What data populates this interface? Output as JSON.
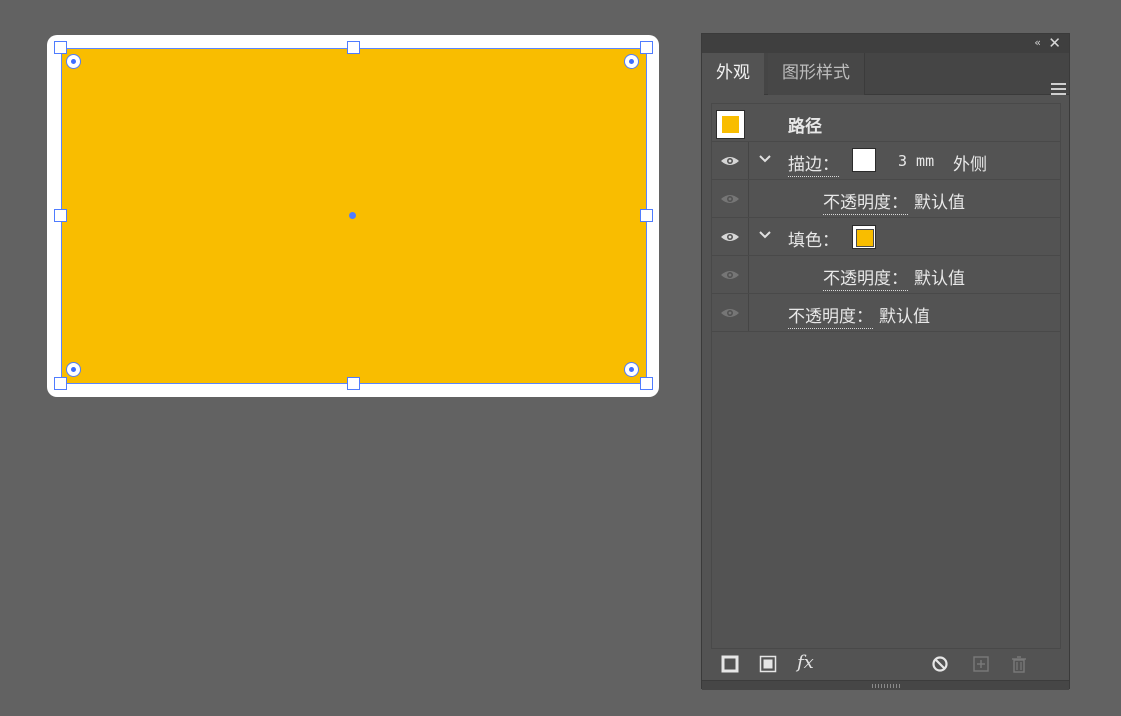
{
  "colors": {
    "canvas_bg": "#626262",
    "fill": "#f9bd00",
    "stroke": "#ffffff",
    "selection": "#4f7cff",
    "panel_bg": "#535353"
  },
  "panel": {
    "tabs": [
      {
        "label": "外观",
        "active": true
      },
      {
        "label": "图形样式",
        "active": false
      }
    ],
    "collapse_icon": "double-chevron-left-icon",
    "close_icon": "close-icon",
    "menu_icon": "hamburger-menu-icon"
  },
  "appearance": {
    "object_label": "路径",
    "stroke": {
      "label": "描边：",
      "value": "3 mm",
      "position": "外侧",
      "opacity_label": "不透明度：",
      "opacity_value": "默认值"
    },
    "fill": {
      "label": "填色：",
      "opacity_label": "不透明度：",
      "opacity_value": "默认值"
    },
    "object_opacity": {
      "label": "不透明度：",
      "value": "默认值"
    }
  },
  "footer_icons": [
    "add-new-stroke-icon",
    "add-new-fill-icon",
    "add-new-effect-icon",
    "clear-appearance-icon",
    "duplicate-item-icon",
    "delete-item-icon"
  ],
  "footer": {
    "fx_label": "fx"
  }
}
